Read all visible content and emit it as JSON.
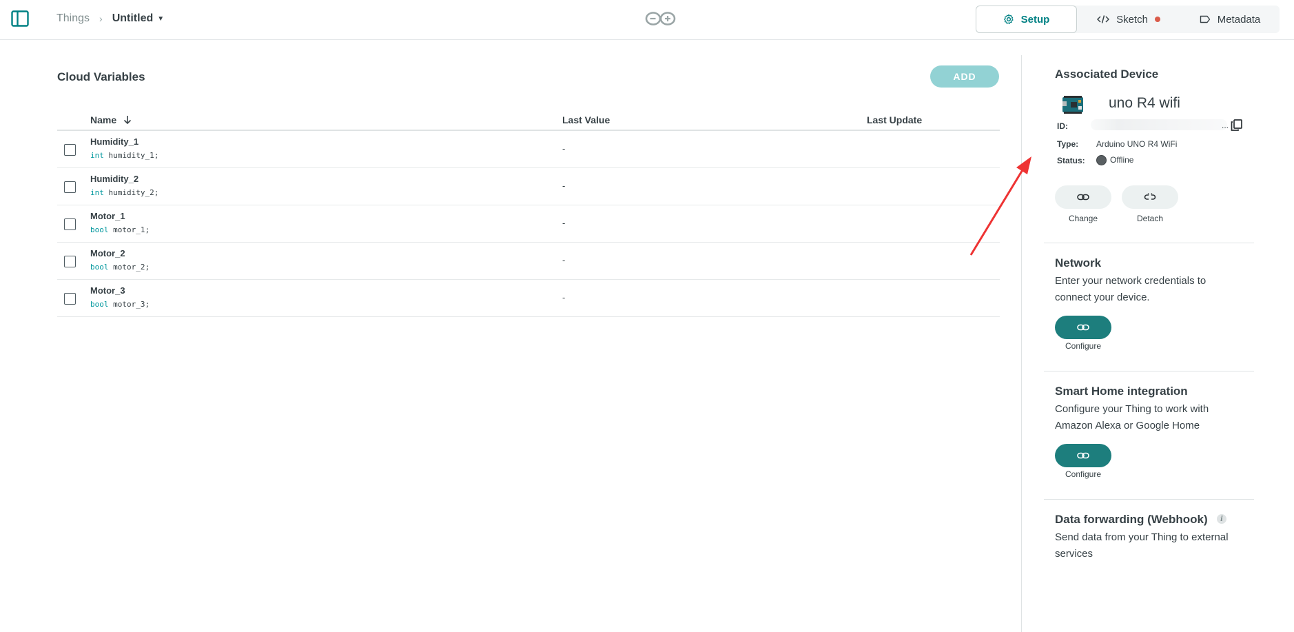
{
  "topbar": {
    "breadcrumb_root": "Things",
    "breadcrumb_current": "Untitled",
    "tabs": [
      {
        "label": "Setup",
        "icon": "gear-icon",
        "active": true
      },
      {
        "label": "Sketch",
        "icon": "code-icon",
        "badge_color": "#da5b4a"
      },
      {
        "label": "Metadata",
        "icon": "tag-icon"
      }
    ]
  },
  "main": {
    "title": "Cloud Variables",
    "add_label": "ADD",
    "columns": {
      "name": "Name",
      "last_value": "Last Value",
      "last_update": "Last Update"
    },
    "variables": [
      {
        "name": "Humidity_1",
        "type": "int",
        "decl": "humidity_1;",
        "value": "-"
      },
      {
        "name": "Humidity_2",
        "type": "int",
        "decl": "humidity_2;",
        "value": "-"
      },
      {
        "name": "Motor_1",
        "type": "bool",
        "decl": "motor_1;",
        "value": "-"
      },
      {
        "name": "Motor_2",
        "type": "bool",
        "decl": "motor_2;",
        "value": "-"
      },
      {
        "name": "Motor_3",
        "type": "bool",
        "decl": "motor_3;",
        "value": "-"
      }
    ]
  },
  "device": {
    "title": "Associated Device",
    "name": "uno R4 wifi",
    "id_label": "ID:",
    "id_suffix": "...",
    "type_label": "Type:",
    "type_value": "Arduino UNO R4 WiFi",
    "status_label": "Status:",
    "status_value": "Offline",
    "change_label": "Change",
    "detach_label": "Detach"
  },
  "network": {
    "title": "Network",
    "text": "Enter your network credentials to connect your device.",
    "button_label": "Configure"
  },
  "smart_home": {
    "title": "Smart Home integration",
    "text": "Configure your Thing to work with Amazon Alexa or Google Home",
    "button_label": "Configure"
  },
  "webhook": {
    "title": "Data forwarding (Webhook)",
    "text": "Send data from your Thing to external services"
  },
  "colors": {
    "accent": "#008184",
    "button_dark": "#1d7e7d",
    "add_button": "#7fcbcd",
    "annotation_arrow": "#ee3333"
  }
}
